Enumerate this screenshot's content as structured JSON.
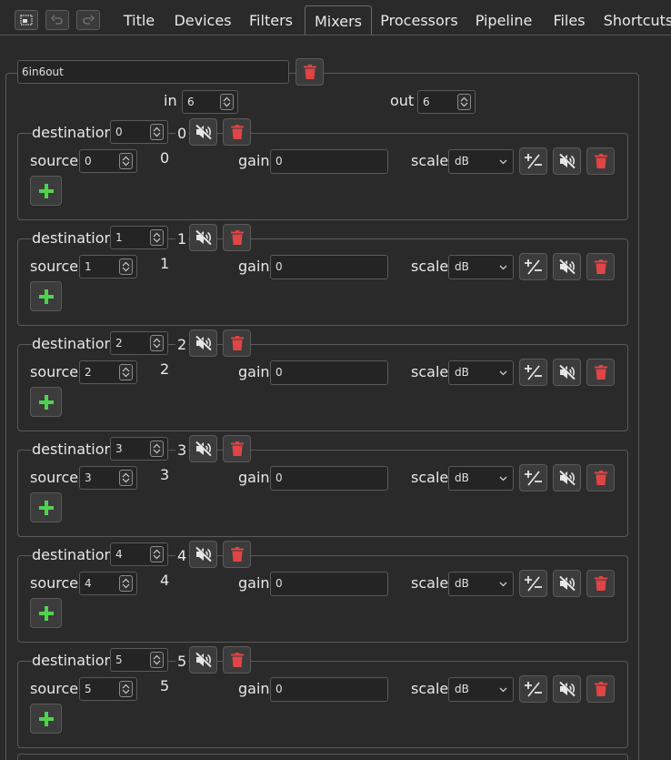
{
  "toolbar": {
    "icons": [
      "window-icon",
      "undo-icon",
      "redo-icon"
    ]
  },
  "tabs": [
    {
      "label": "Title",
      "active": false
    },
    {
      "label": "Devices",
      "active": false
    },
    {
      "label": "Filters",
      "active": false
    },
    {
      "label": "Mixers",
      "active": true
    },
    {
      "label": "Processors",
      "active": false
    },
    {
      "label": "Pipeline",
      "active": false
    },
    {
      "label": "Files",
      "active": false
    },
    {
      "label": "Shortcuts",
      "active": false
    }
  ],
  "mixer": {
    "name": "6in6out",
    "in_label": "in",
    "in_value": "6",
    "out_label": "out",
    "out_value": "6",
    "destinations": [
      {
        "label": "destination",
        "value": "0",
        "display": "0",
        "source_label": "source",
        "source_value": "0",
        "source_display": "0",
        "gain_label": "gain",
        "gain_value": "0",
        "scale_label": "scale",
        "scale_value": "dB"
      },
      {
        "label": "destination",
        "value": "1",
        "display": "1",
        "source_label": "source",
        "source_value": "1",
        "source_display": "1",
        "gain_label": "gain",
        "gain_value": "0",
        "scale_label": "scale",
        "scale_value": "dB"
      },
      {
        "label": "destination",
        "value": "2",
        "display": "2",
        "source_label": "source",
        "source_value": "2",
        "source_display": "2",
        "gain_label": "gain",
        "gain_value": "0",
        "scale_label": "scale",
        "scale_value": "dB"
      },
      {
        "label": "destination",
        "value": "3",
        "display": "3",
        "source_label": "source",
        "source_value": "3",
        "source_display": "3",
        "gain_label": "gain",
        "gain_value": "0",
        "scale_label": "scale",
        "scale_value": "dB"
      },
      {
        "label": "destination",
        "value": "4",
        "display": "4",
        "source_label": "source",
        "source_value": "4",
        "source_display": "4",
        "gain_label": "gain",
        "gain_value": "0",
        "scale_label": "scale",
        "scale_value": "dB"
      },
      {
        "label": "destination",
        "value": "5",
        "display": "5",
        "source_label": "source",
        "source_value": "5",
        "source_display": "5",
        "gain_label": "gain",
        "gain_value": "0",
        "scale_label": "scale",
        "scale_value": "dB"
      }
    ]
  },
  "colors": {
    "background": "#2a2a2a",
    "delete_red": "#e04545",
    "add_green": "#4fd34f",
    "border": "#5a5a5a"
  }
}
